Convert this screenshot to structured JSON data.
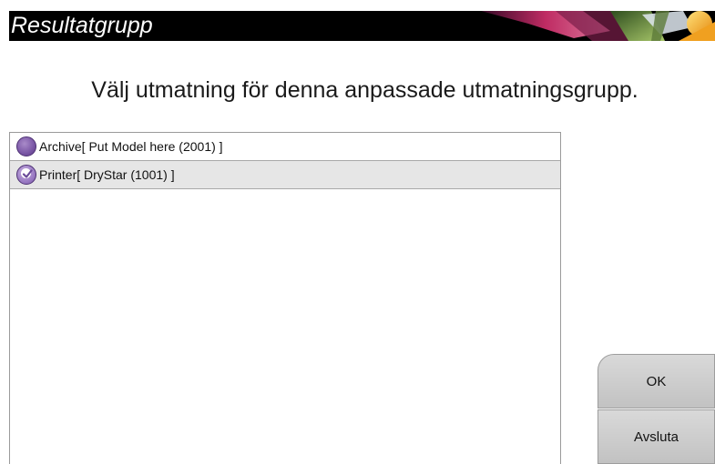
{
  "window": {
    "title": "Resultatgrupp"
  },
  "main": {
    "heading": "Välj utmatning för denna anpassade utmatningsgrupp.",
    "outputs": [
      {
        "label": "Archive[ Put Model here (2001) ]",
        "selected": false
      },
      {
        "label": "Printer[ DryStar (1001) ]",
        "selected": true
      }
    ]
  },
  "buttons": {
    "ok_label": "OK",
    "exit_label": "Avsluta"
  },
  "colors": {
    "titlebar": "#000000",
    "radio": "#7d5aa8",
    "selected_row": "#e6e6e6",
    "button": "#cccccc"
  },
  "icons": {
    "title_art": "flower-banner",
    "radio_off": "radio-unchecked-icon",
    "radio_on": "radio-checked-icon"
  }
}
